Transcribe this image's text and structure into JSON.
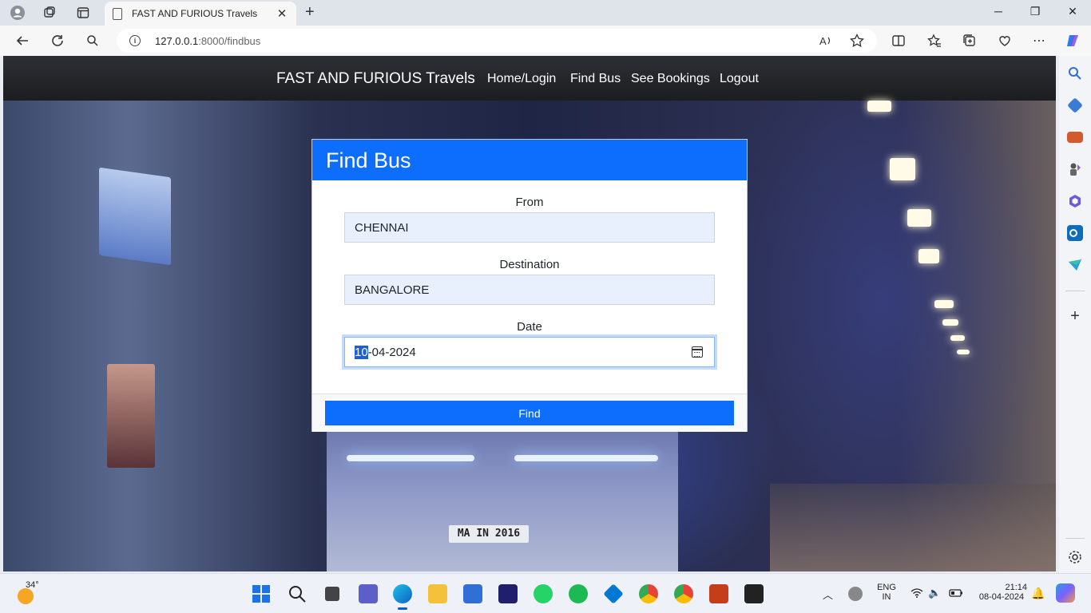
{
  "browser": {
    "tab_title": "FAST AND FURIOUS Travels",
    "url_host": "127.0.0.1",
    "url_rest": ":8000/findbus"
  },
  "site": {
    "brand": "FAST AND FURIOUS Travels",
    "nav": [
      "Home/Login",
      "Find Bus",
      "See Bookings",
      "Logout"
    ]
  },
  "background": {
    "plate_text": "MA IN 2016"
  },
  "form": {
    "title": "Find Bus",
    "from_label": "From",
    "from_value": "CHENNAI",
    "destination_label": "Destination",
    "destination_value": "BANGALORE",
    "date_label": "Date",
    "date_day_selected": "10",
    "date_rest": "-04-2024",
    "submit_label": "Find"
  },
  "taskbar": {
    "temperature": "34°",
    "lang_top": "ENG",
    "lang_bottom": "IN",
    "time": "21:14",
    "date": "08-04-2024"
  },
  "colors": {
    "primary": "#0d6efd",
    "navbar": "#212529"
  }
}
